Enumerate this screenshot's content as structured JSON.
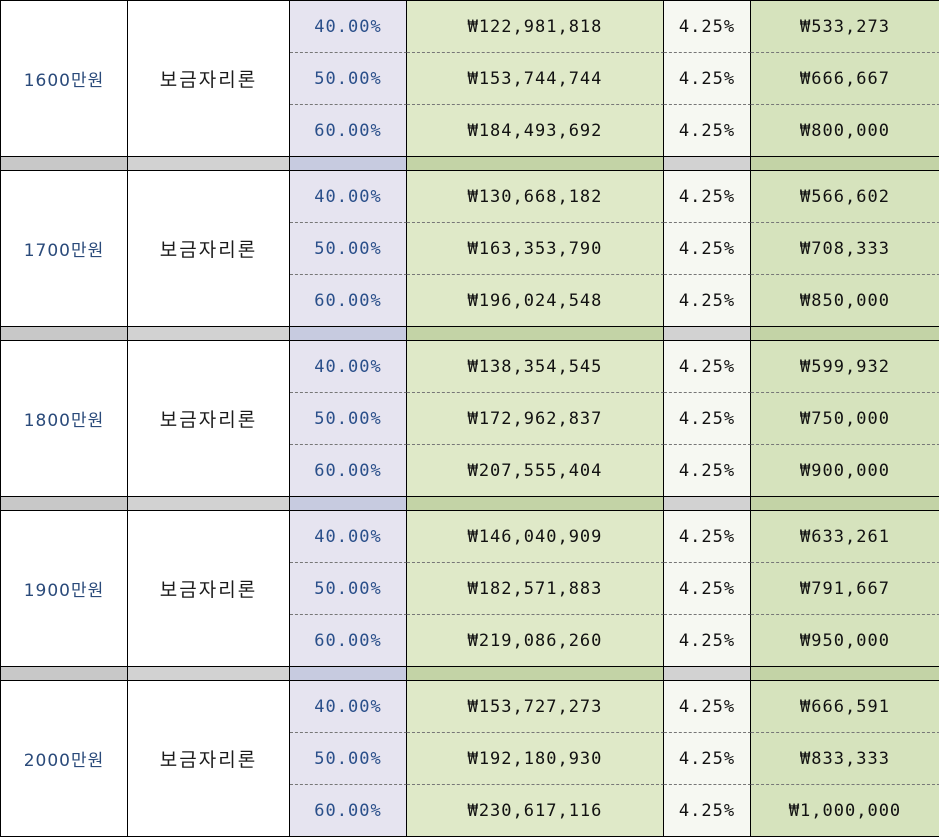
{
  "groups": [
    {
      "income": "1600만원",
      "product": "보금자리론",
      "rows": [
        {
          "ltv": "40.00%",
          "loan": "₩122,981,818",
          "rate": "4.25%",
          "payment": "₩533,273"
        },
        {
          "ltv": "50.00%",
          "loan": "₩153,744,744",
          "rate": "4.25%",
          "payment": "₩666,667"
        },
        {
          "ltv": "60.00%",
          "loan": "₩184,493,692",
          "rate": "4.25%",
          "payment": "₩800,000"
        }
      ]
    },
    {
      "income": "1700만원",
      "product": "보금자리론",
      "rows": [
        {
          "ltv": "40.00%",
          "loan": "₩130,668,182",
          "rate": "4.25%",
          "payment": "₩566,602"
        },
        {
          "ltv": "50.00%",
          "loan": "₩163,353,790",
          "rate": "4.25%",
          "payment": "₩708,333"
        },
        {
          "ltv": "60.00%",
          "loan": "₩196,024,548",
          "rate": "4.25%",
          "payment": "₩850,000"
        }
      ]
    },
    {
      "income": "1800만원",
      "product": "보금자리론",
      "rows": [
        {
          "ltv": "40.00%",
          "loan": "₩138,354,545",
          "rate": "4.25%",
          "payment": "₩599,932"
        },
        {
          "ltv": "50.00%",
          "loan": "₩172,962,837",
          "rate": "4.25%",
          "payment": "₩750,000"
        },
        {
          "ltv": "60.00%",
          "loan": "₩207,555,404",
          "rate": "4.25%",
          "payment": "₩900,000"
        }
      ]
    },
    {
      "income": "1900만원",
      "product": "보금자리론",
      "rows": [
        {
          "ltv": "40.00%",
          "loan": "₩146,040,909",
          "rate": "4.25%",
          "payment": "₩633,261"
        },
        {
          "ltv": "50.00%",
          "loan": "₩182,571,883",
          "rate": "4.25%",
          "payment": "₩791,667"
        },
        {
          "ltv": "60.00%",
          "loan": "₩219,086,260",
          "rate": "4.25%",
          "payment": "₩950,000"
        }
      ]
    },
    {
      "income": "2000만원",
      "product": "보금자리론",
      "rows": [
        {
          "ltv": "40.00%",
          "loan": "₩153,727,273",
          "rate": "4.25%",
          "payment": "₩666,591"
        },
        {
          "ltv": "50.00%",
          "loan": "₩192,180,930",
          "rate": "4.25%",
          "payment": "₩833,333"
        },
        {
          "ltv": "60.00%",
          "loan": "₩230,617,116",
          "rate": "4.25%",
          "payment": "₩1,000,000"
        }
      ]
    }
  ]
}
